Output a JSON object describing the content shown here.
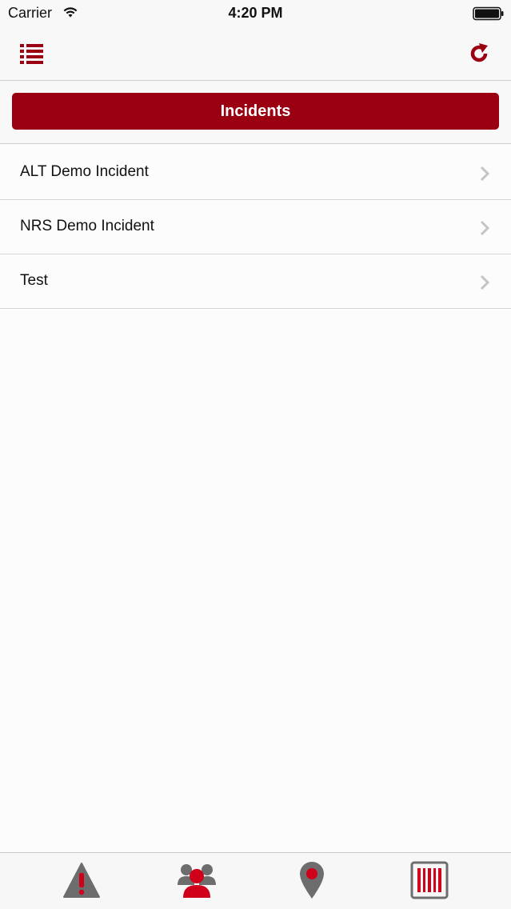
{
  "status_bar": {
    "carrier": "Carrier",
    "time": "4:20 PM",
    "wifi_icon": "wifi-icon",
    "battery_icon": "battery-icon"
  },
  "nav_bar": {
    "menu_icon": "list-menu-icon",
    "refresh_icon": "refresh-icon"
  },
  "header": {
    "title": "Incidents"
  },
  "incidents": [
    {
      "label": "ALT Demo Incident"
    },
    {
      "label": "NRS Demo Incident"
    },
    {
      "label": "Test"
    }
  ],
  "tab_bar": {
    "tabs": [
      {
        "icon": "warning-icon"
      },
      {
        "icon": "people-icon"
      },
      {
        "icon": "map-pin-icon"
      },
      {
        "icon": "barcode-icon"
      }
    ]
  },
  "colors": {
    "accent": "#9a0012",
    "icon_gray": "#6d6d6d",
    "background": "#fcfcfc"
  }
}
